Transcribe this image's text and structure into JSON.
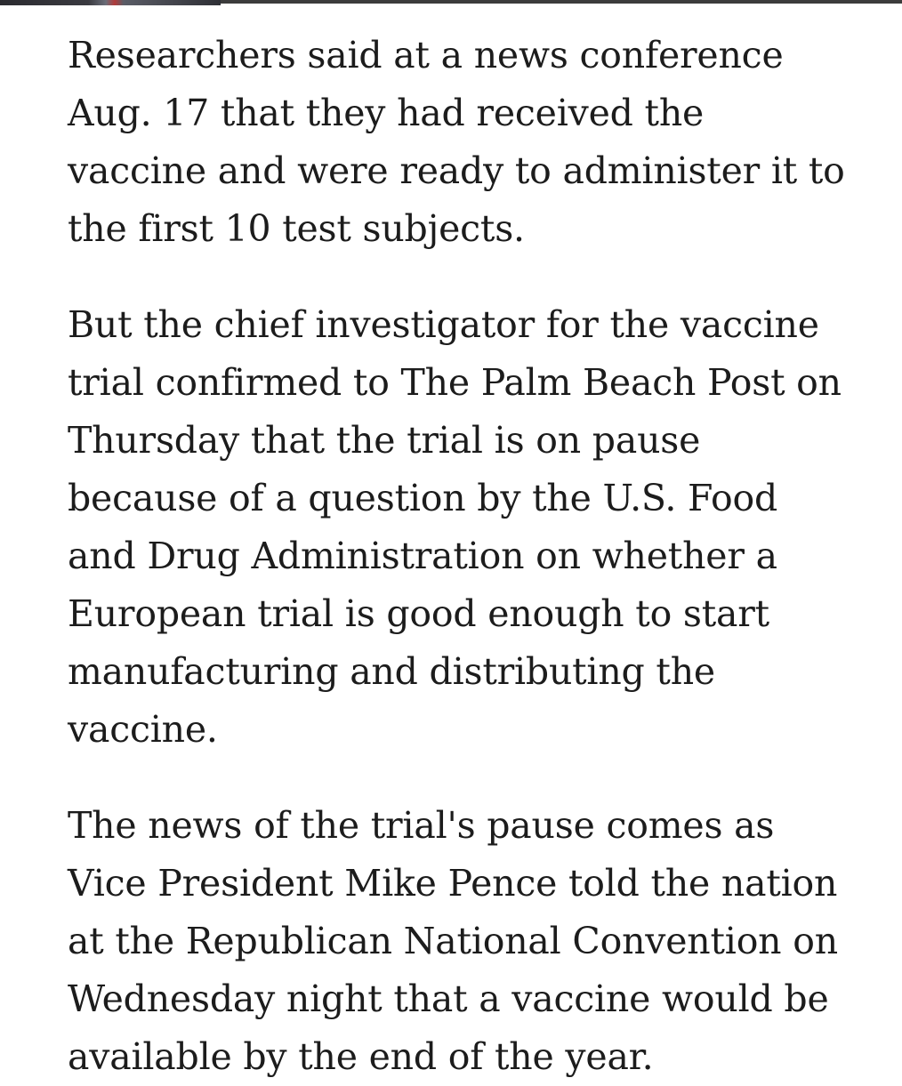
{
  "article": {
    "paragraphs": [
      "Researchers said at a news conference Aug. 17 that they had received the vaccine and were ready to administer it to the first 10 test subjects.",
      "But the chief investigator for the vaccine trial confirmed to The Palm Beach Post on Thursday that the trial is on pause because of a question by the U.S. Food and Drug Administration on whether a European trial is good enough to start manufacturing and distributing the vaccine.",
      "The news of the trial's pause comes as Vice President Mike Pence told the nation at the Republican National Convention on Wednesday night that a vaccine would be available by the end of the year."
    ]
  }
}
